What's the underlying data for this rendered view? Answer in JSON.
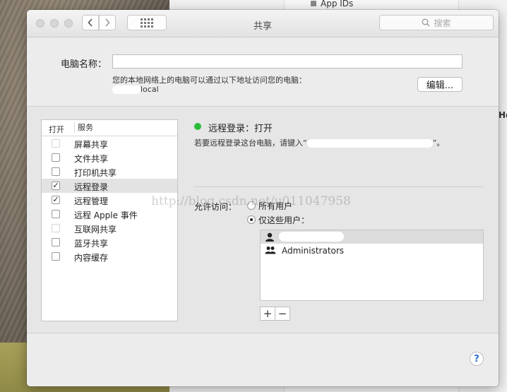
{
  "background": {
    "appids_label": "App IDs",
    "he_label": "He"
  },
  "window": {
    "title": "共享",
    "search_placeholder": "搜索",
    "computer_name_label": "电脑名称：",
    "computer_name_value": "",
    "address_hint": "您的本地网络上的电脑可以通过以下地址访问您的电脑：",
    "address_value": "local",
    "edit_button": "编辑...",
    "services": {
      "col_open": "打开",
      "col_service": "服务",
      "items": [
        {
          "label": "屏幕共享",
          "checked": false,
          "enabled": false
        },
        {
          "label": "文件共享",
          "checked": false,
          "enabled": true
        },
        {
          "label": "打印机共享",
          "checked": false,
          "enabled": true
        },
        {
          "label": "远程登录",
          "checked": true,
          "enabled": true,
          "selected": true
        },
        {
          "label": "远程管理",
          "checked": true,
          "enabled": true
        },
        {
          "label": "远程 Apple 事件",
          "checked": false,
          "enabled": true
        },
        {
          "label": "互联网共享",
          "checked": false,
          "enabled": false
        },
        {
          "label": "蓝牙共享",
          "checked": false,
          "enabled": true
        },
        {
          "label": "内容缓存",
          "checked": false,
          "enabled": true
        }
      ]
    },
    "status": {
      "text": "远程登录：打开",
      "color": "#2bbd3a",
      "hint_prefix": "若要远程登录这台电脑，请键入“",
      "hint_suffix": "”。"
    },
    "access": {
      "label": "允许访问：",
      "option_all": "所有用户",
      "option_these": "仅这些用户：",
      "selected": "these"
    },
    "users": [
      {
        "name": "",
        "icon": "user-icon",
        "selected": true
      },
      {
        "name": "Administrators",
        "icon": "group-icon",
        "selected": false
      }
    ],
    "add_button": "+",
    "remove_button": "−",
    "help_button": "?"
  },
  "watermark": "http://blog.csdn.net/u011047958"
}
